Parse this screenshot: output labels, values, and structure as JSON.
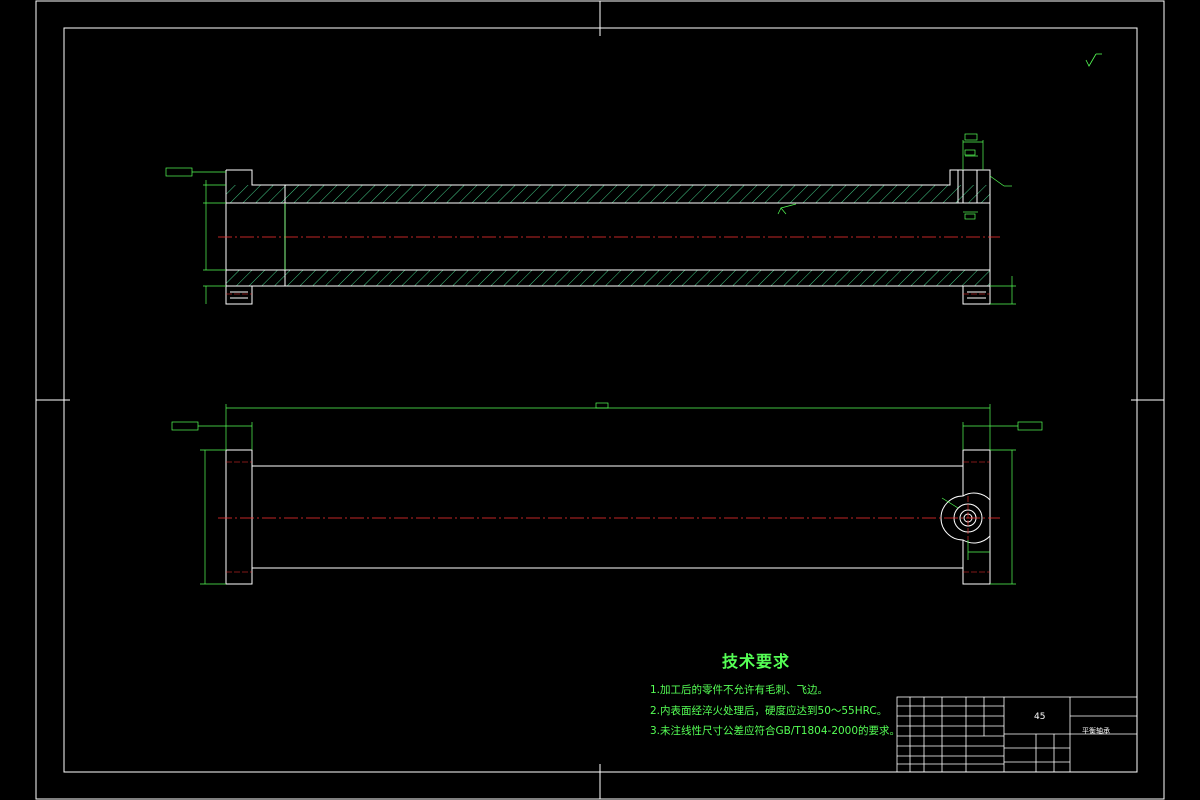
{
  "tech_requirements": {
    "title": "技术要求",
    "items": [
      "1.加工后的零件不允许有毛刺、飞边。",
      "2.内表面经淬火处理后，硬度应达到50～55HRC。",
      "3.未注线性尺寸公差应符合GB/T1804-2000的要求。"
    ]
  },
  "title_block": {
    "material": "45",
    "part_name": "平衡轴承"
  },
  "colors": {
    "background": "#000000",
    "frame": "#ffffff",
    "dimension": "#55ff55",
    "centerline": "#ff3333",
    "hatch": "#55ffaa"
  }
}
